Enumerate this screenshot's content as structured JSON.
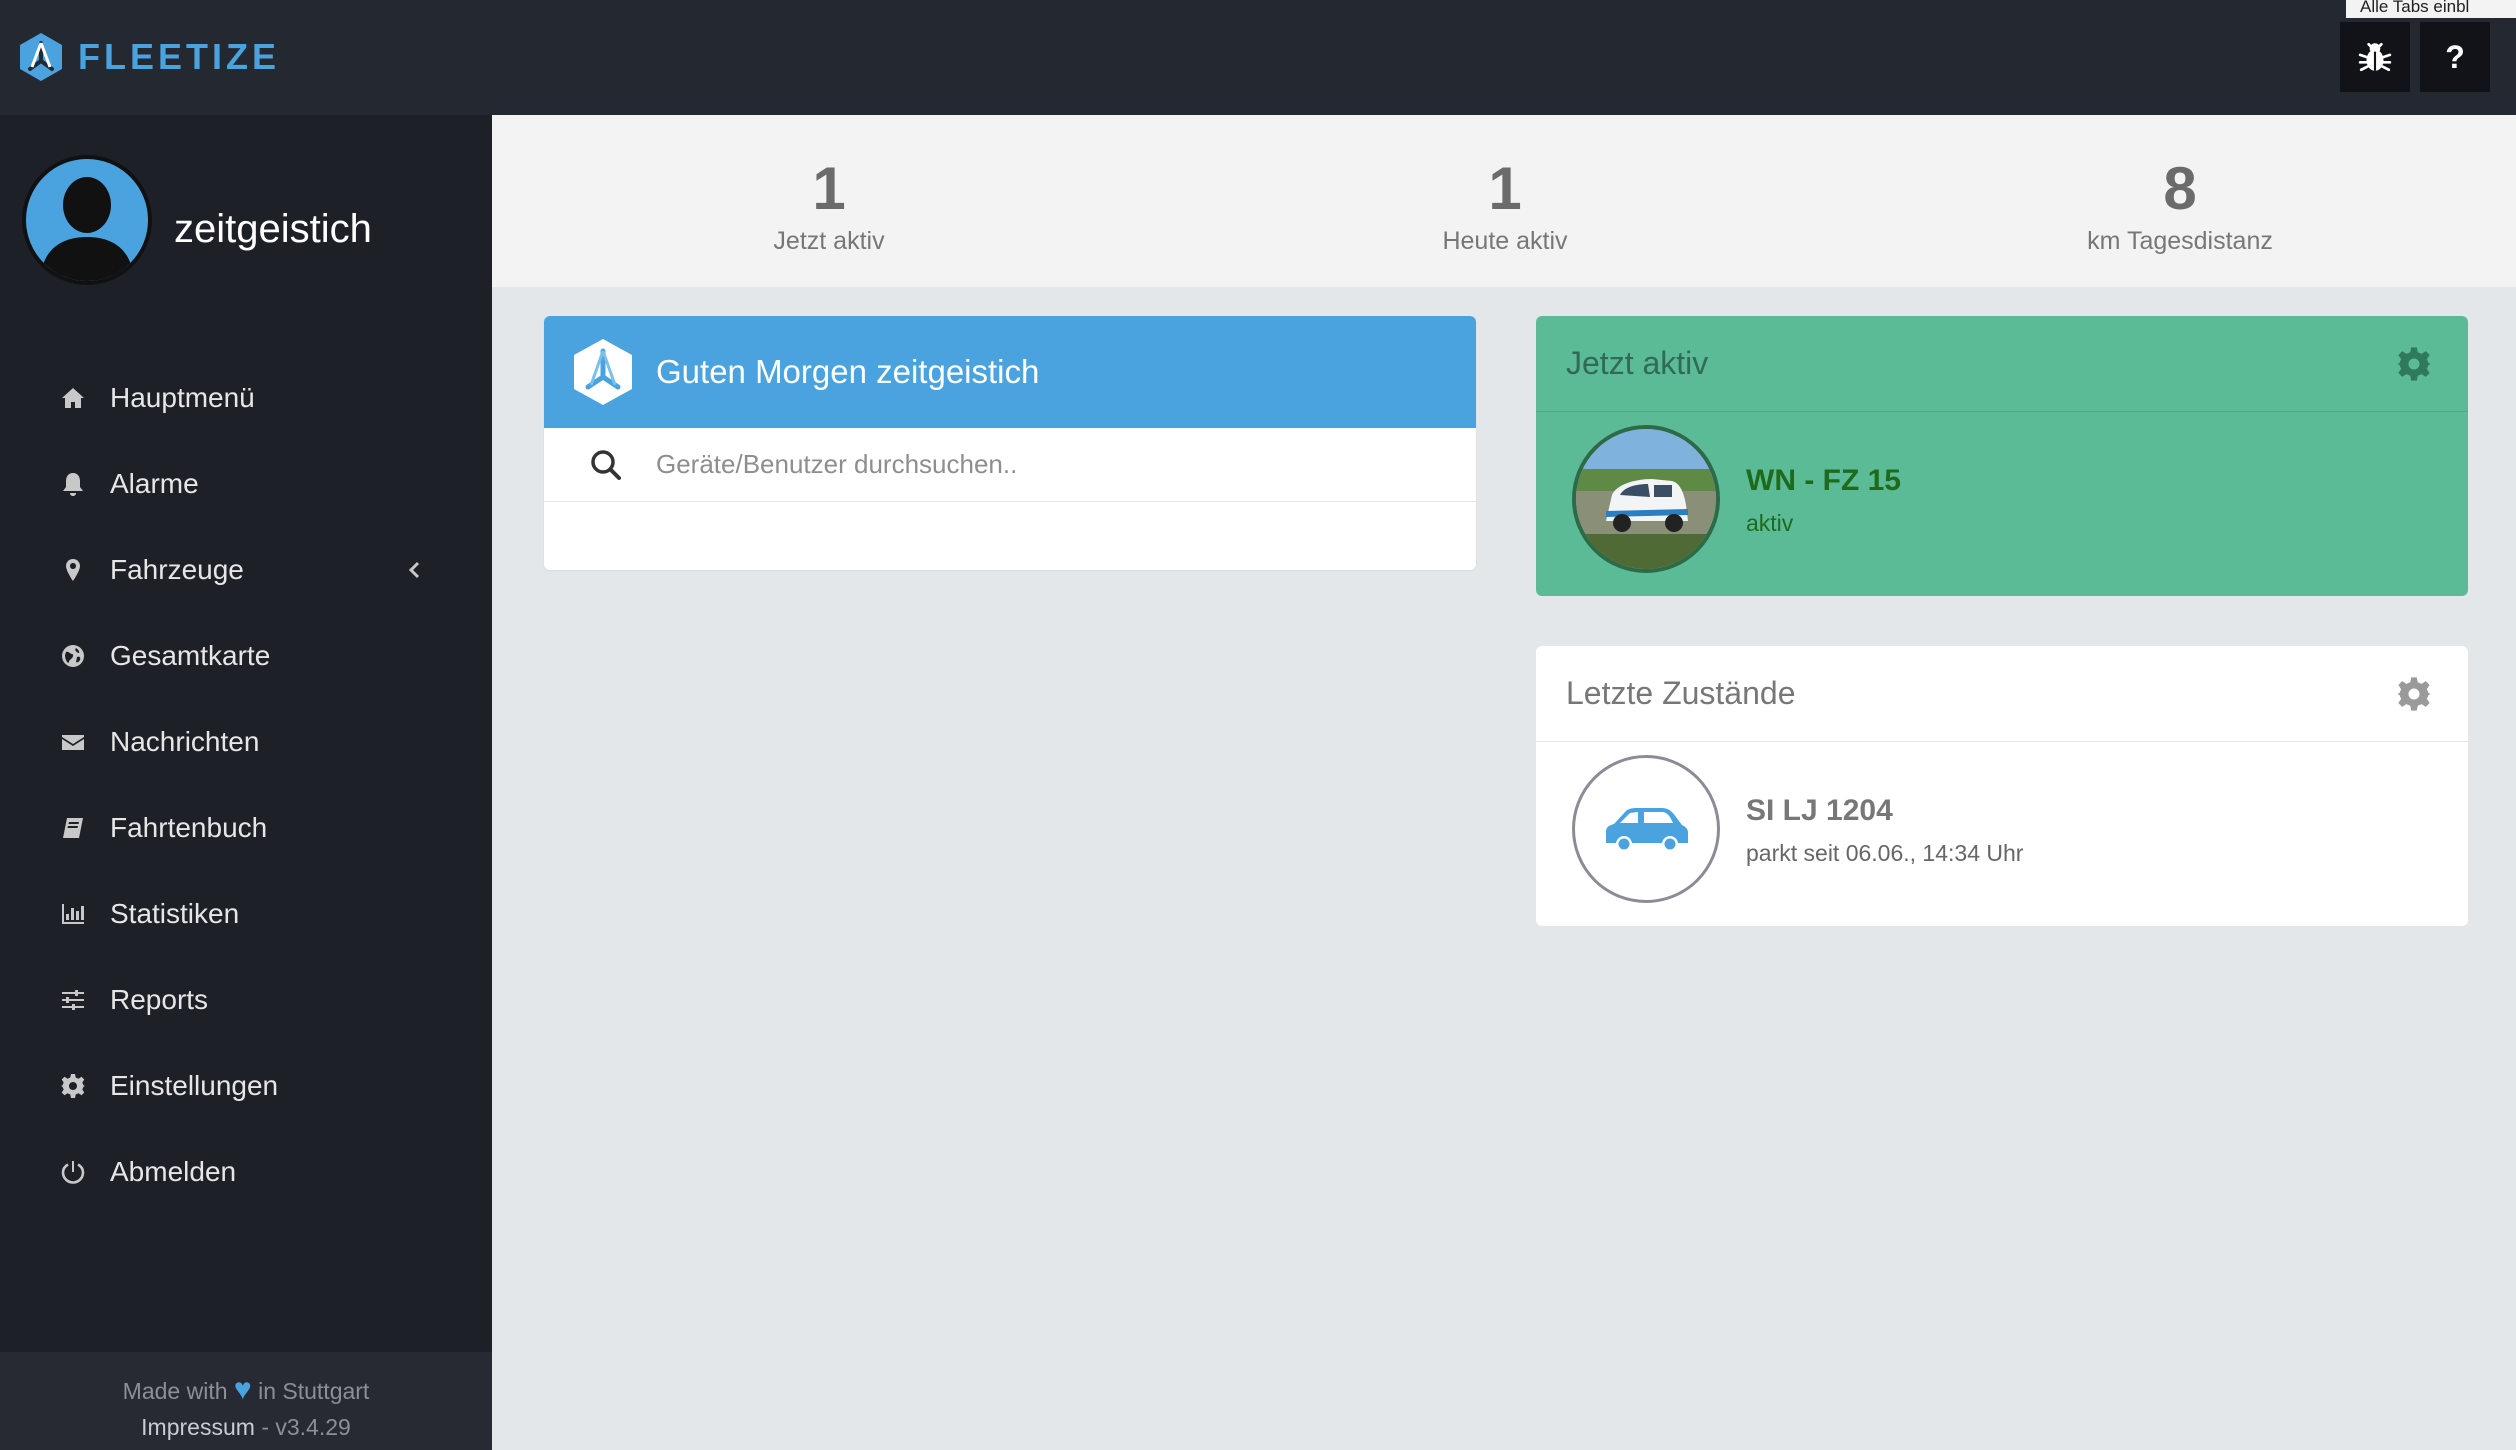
{
  "app": {
    "brand": "FLEETIZE",
    "tooltip": "Alle Tabs einbl"
  },
  "colors": {
    "accent": "#4aa3df",
    "active_green": "#5bbb97",
    "sidebar": "#1e2027",
    "topbar": "#242831"
  },
  "topbar": {
    "bug_icon": "bug-icon",
    "help_label": "?"
  },
  "profile": {
    "username": "zeitgeistich"
  },
  "sidebar": {
    "items": [
      {
        "label": "Hauptmenü",
        "icon": "home-icon"
      },
      {
        "label": "Alarme",
        "icon": "bell-icon"
      },
      {
        "label": "Fahrzeuge",
        "icon": "map-marker-icon"
      },
      {
        "label": "Gesamtkarte",
        "icon": "globe-icon"
      },
      {
        "label": "Nachrichten",
        "icon": "envelope-icon"
      },
      {
        "label": "Fahrtenbuch",
        "icon": "book-icon"
      },
      {
        "label": "Statistiken",
        "icon": "bar-chart-icon"
      },
      {
        "label": "Reports",
        "icon": "sliders-icon"
      },
      {
        "label": "Einstellungen",
        "icon": "gear-icon"
      },
      {
        "label": "Abmelden",
        "icon": "power-icon"
      }
    ]
  },
  "footer": {
    "made_with": "Made with",
    "in_city": "in Stuttgart",
    "impressum": "Impressum",
    "version": "- v3.4.29"
  },
  "stats": [
    {
      "value": "1",
      "label": "Jetzt aktiv"
    },
    {
      "value": "1",
      "label": "Heute aktiv"
    },
    {
      "value": "8",
      "label": "km Tagesdistanz"
    }
  ],
  "welcome": {
    "title": "Guten Morgen zeitgeistich",
    "search_placeholder": "Geräte/Benutzer durchsuchen.."
  },
  "active_card": {
    "title": "Jetzt aktiv",
    "vehicle_name": "WN - FZ 15",
    "vehicle_status": "aktiv"
  },
  "states_card": {
    "title": "Letzte Zustände",
    "vehicle_name": "SI LJ 1204",
    "vehicle_status": "parkt seit 06.06., 14:34 Uhr"
  }
}
